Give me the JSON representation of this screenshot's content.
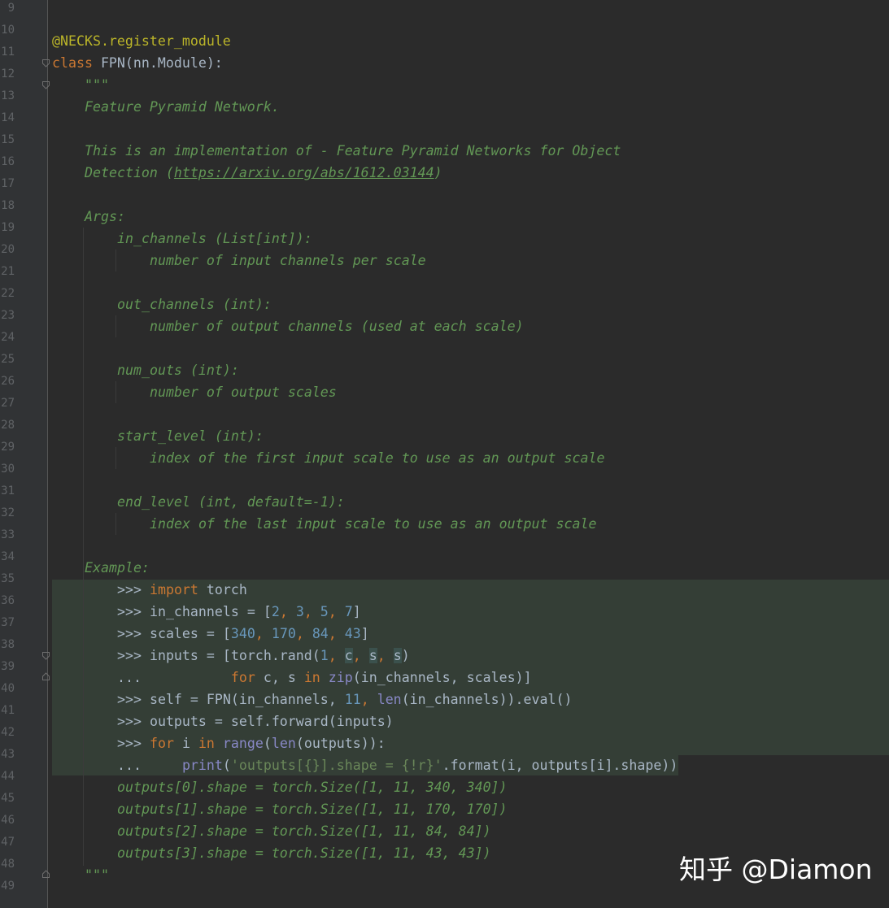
{
  "editor": {
    "line_numbers": [
      "9",
      "10",
      "11",
      "12",
      "13",
      "14",
      "15",
      "16",
      "17",
      "18",
      "19",
      "20",
      "21",
      "22",
      "23",
      "24",
      "25",
      "26",
      "27",
      "28",
      "29",
      "30",
      "31",
      "32",
      "33",
      "34",
      "35",
      "36",
      "37",
      "38",
      "39",
      "40",
      "41",
      "42",
      "43",
      "44",
      "45",
      "46",
      "47",
      "48",
      "49"
    ],
    "code": {
      "l10_decorator": "@NECKS.register_module",
      "l11_kw": "class",
      "l11_rest": " FPN(nn.Module):",
      "l12": "\"\"\"",
      "l13": "Feature Pyramid Network.",
      "l15": "This is an implementation of - Feature Pyramid Networks for Object",
      "l16_a": "Detection (",
      "l16_link": "https://arxiv.org/abs/1612.03144",
      "l16_b": ")",
      "l18": "Args:",
      "l19": "in_channels (List[int]):",
      "l20": "number of input channels per scale",
      "l22": "out_channels (int):",
      "l23": "number of output channels (used at each scale)",
      "l25": "num_outs (int):",
      "l26": "number of output scales",
      "l28": "start_level (int):",
      "l29": "index of the first input scale to use as an output scale",
      "l31": "end_level (int, default=-1):",
      "l32": "index of the last input scale to use as an output scale",
      "l34": "Example:",
      "l35_a": ">>> ",
      "l35_kw": "import",
      "l35_b": " torch",
      "l36_a": ">>> in_channels = [",
      "l36_n1": "2",
      "l36_c1": ", ",
      "l36_n2": "3",
      "l36_c2": ", ",
      "l36_n3": "5",
      "l36_c3": ", ",
      "l36_n4": "7",
      "l36_b": "]",
      "l37_a": ">>> scales = [",
      "l37_n1": "340",
      "l37_c1": ", ",
      "l37_n2": "170",
      "l37_c2": ", ",
      "l37_n3": "84",
      "l37_c3": ", ",
      "l37_n4": "43",
      "l37_b": "]",
      "l38_a": ">>> inputs = [torch.rand(",
      "l38_n1": "1",
      "l38_c1": ", ",
      "l38_v1": "c",
      "l38_c2": ", ",
      "l38_v2": "s",
      "l38_c3": ", ",
      "l38_v3": "s",
      "l38_b": ")",
      "l39_a": "...           ",
      "l39_kw1": "for",
      "l39_b": " c, s ",
      "l39_kw2": "in",
      "l39_c": " ",
      "l39_bi": "zip",
      "l39_d": "(in_channels, scales)]",
      "l40_a": ">>> self = FPN(in_channels, ",
      "l40_n": "11",
      "l40_c": ", ",
      "l40_bi": "len",
      "l40_b": "(in_channels)).eval()",
      "l41": ">>> outputs = self.forward(inputs)",
      "l42_a": ">>> ",
      "l42_kw1": "for",
      "l42_b": " i ",
      "l42_kw2": "in",
      "l42_c": " ",
      "l42_bi1": "range",
      "l42_d": "(",
      "l42_bi2": "len",
      "l42_e": "(outputs)):",
      "l43_a": "...     ",
      "l43_bi": "print",
      "l43_b": "(",
      "l43_str": "'outputs[{}].shape = {!r}'",
      "l43_c": ".format(i, outputs[i].shape))",
      "l44": "outputs[0].shape = torch.Size([1, 11, 340, 340])",
      "l45": "outputs[1].shape = torch.Size([1, 11, 170, 170])",
      "l46": "outputs[2].shape = torch.Size([1, 11, 84, 84])",
      "l47": "outputs[3].shape = torch.Size([1, 11, 43, 43])",
      "l48": "\"\"\""
    }
  },
  "watermark": "知乎 @Diamon"
}
